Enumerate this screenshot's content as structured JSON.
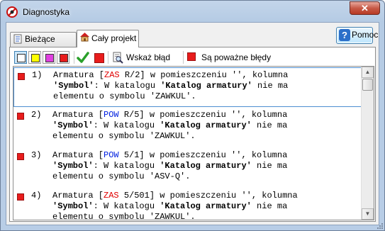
{
  "window": {
    "title": "Diagnostyka",
    "close_label": "✕"
  },
  "tabs": [
    {
      "label": "Bieżące dane",
      "icon": "document-icon"
    },
    {
      "label": "Cały projekt",
      "icon": "house-icon"
    }
  ],
  "help_button": {
    "label": "Pomoc",
    "icon_text": "?"
  },
  "toolbar": {
    "filters": [
      {
        "color": "#ffffff",
        "name": "white"
      },
      {
        "color": "#ffff00",
        "name": "yellow"
      },
      {
        "color": "#e040e0",
        "name": "magenta"
      },
      {
        "color": "#e81c1c",
        "name": "red"
      }
    ],
    "show_error_label": "Wskaż błąd",
    "severity_label": "Są poważne błędy",
    "severity_color": "#e81c1c"
  },
  "items": [
    {
      "num": "1)",
      "a_pre": "Armatura [",
      "code": "ZAS",
      "code_color": "red",
      "a_post": " R/2] w pomieszczeniu '', kolumna",
      "line2_a": "'Symbol'",
      "line2_b": ": W katalogu ",
      "line2_c": "'Katalog armatury'",
      "line2_d": " nie ma",
      "line3": "elementu o symbolu 'ZAWKUL'."
    },
    {
      "num": "2)",
      "a_pre": "Armatura [",
      "code": "POW",
      "code_color": "blue",
      "a_post": " R/5] w pomieszczeniu '', kolumna",
      "line2_a": "'Symbol'",
      "line2_b": ": W katalogu ",
      "line2_c": "'Katalog armatury'",
      "line2_d": " nie ma",
      "line3": "elementu o symbolu 'ZAWKUL'."
    },
    {
      "num": "3)",
      "a_pre": "Armatura [",
      "code": "POW",
      "code_color": "blue",
      "a_post": " 5/1] w pomieszczeniu '', kolumna",
      "line2_a": "'Symbol'",
      "line2_b": ": W katalogu ",
      "line2_c": "'Katalog armatury'",
      "line2_d": " nie ma",
      "line3": "elementu o symbolu 'ASV-Q'."
    },
    {
      "num": "4)",
      "a_pre": "Armatura [",
      "code": "ZAS",
      "code_color": "red",
      "a_post": " 5/501] w pomieszczeniu '', kolumna",
      "line2_a": "'Symbol'",
      "line2_b": ": W katalogu ",
      "line2_c": "'Katalog armatury'",
      "line2_d": " nie ma",
      "line3": "elementu o symbolu 'ZAWKUL'."
    }
  ]
}
